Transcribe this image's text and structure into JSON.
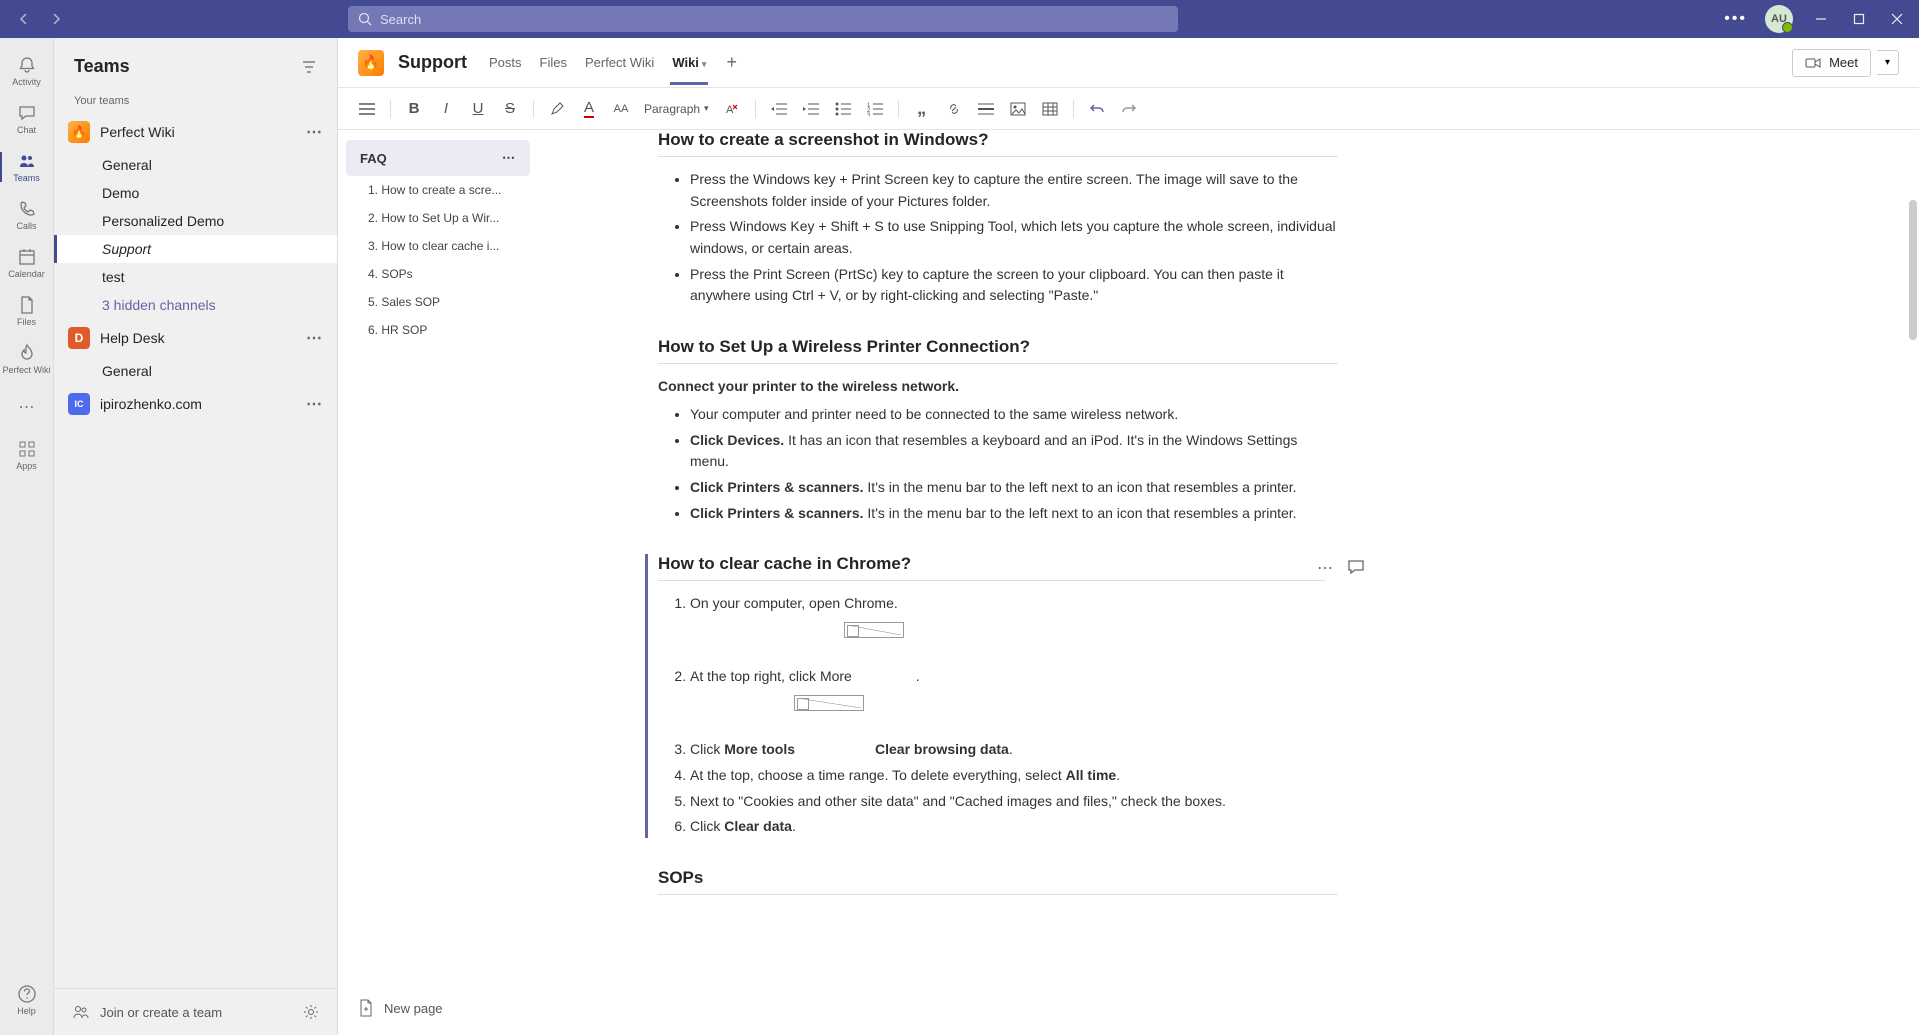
{
  "titlebar": {
    "search_placeholder": "Search",
    "avatar_initials": "AU"
  },
  "rail": {
    "items": [
      {
        "label": "Activity",
        "icon": "🔔"
      },
      {
        "label": "Chat",
        "icon": "💬"
      },
      {
        "label": "Teams",
        "icon": "👥",
        "active": true
      },
      {
        "label": "Calls",
        "icon": "📞"
      },
      {
        "label": "Calendar",
        "icon": "📅"
      },
      {
        "label": "Files",
        "icon": "📄"
      },
      {
        "label": "Perfect Wiki",
        "icon": "🔥"
      },
      {
        "label": "",
        "icon": "⋯"
      },
      {
        "label": "Apps",
        "icon": "⊞"
      }
    ],
    "help_label": "Help"
  },
  "teams_panel": {
    "title": "Teams",
    "your_teams_label": "Your teams",
    "teams": [
      {
        "name": "Perfect Wiki",
        "icon_bg": "linear-gradient(135deg,#ffb347,#ff7b00)",
        "icon_text": "🔥",
        "channels": [
          "General",
          "Demo",
          "Personalized Demo",
          "Support",
          "test"
        ],
        "active_channel": "Support",
        "hidden_link": "3 hidden channels"
      },
      {
        "name": "Help Desk",
        "icon_bg": "#e05b2a",
        "icon_text": "D",
        "channels": [
          "General"
        ]
      },
      {
        "name": "ipirozhenko.com",
        "icon_bg": "#4f6bed",
        "icon_text": "IC",
        "channels": []
      }
    ],
    "join_label": "Join or create a team"
  },
  "header": {
    "channel_title": "Support",
    "tabs": [
      "Posts",
      "Files",
      "Perfect Wiki",
      "Wiki"
    ],
    "active_tab": "Wiki",
    "meet_label": "Meet"
  },
  "toolbar": {
    "paragraph_label": "Paragraph"
  },
  "outline": {
    "title": "FAQ",
    "items": [
      "1. How to create a scre...",
      "2. How to Set Up a Wir...",
      "3. How to clear cache i...",
      "4. SOPs",
      "5. Sales SOP",
      "6. HR SOP"
    ]
  },
  "doc": {
    "sec1": {
      "title": "How to create a screenshot in Windows?",
      "b1": "Press the Windows key + Print Screen key to capture the entire screen. The image will save to the Screenshots folder inside of your Pictures folder.",
      "b2": "Press Windows Key + Shift + S to use Snipping Tool, which lets you capture the whole screen, individual windows, or certain areas.",
      "b3": "Press the Print Screen (PrtSc) key to capture the screen to your clipboard. You can then paste it anywhere using Ctrl + V, or by right-clicking and selecting \"Paste.\""
    },
    "sec2": {
      "title": "How to Set Up a Wireless Printer Connection?",
      "lead_bold": "Connect your printer to the wireless network.",
      "b1": "Your computer and printer need to be connected to the same wireless network.",
      "b2_a": "Click ",
      "b2_b": "Devices.",
      "b2_c": " It has an icon that resembles a keyboard and an iPod. It's in the Windows Settings menu.",
      "b3_a": "Click ",
      "b3_b": "Printers & scanners.",
      "b3_c": " It's in the menu bar to the left next to an icon that resembles a printer.",
      "b4_a": "Click ",
      "b4_b": "Printers & scanners.",
      "b4_c": " It's in the menu bar to the left next to an icon that resembles a printer."
    },
    "sec3": {
      "title": "How to clear cache in Chrome?",
      "o1": "On your computer, open Chrome.",
      "o2": "At the top right, click More ",
      "o3_a": "Click ",
      "o3_b": "More tools",
      "o3_c": "Clear browsing data",
      "o3_d": ".",
      "o4_a": "At the top, choose a time range. To delete everything, select ",
      "o4_b": "All time",
      "o4_c": ".",
      "o5": "Next to \"Cookies and other site data\" and \"Cached images and files,\" check the boxes.",
      "o6_a": "Click ",
      "o6_b": "Clear data",
      "o6_c": "."
    },
    "sec4": {
      "title": "SOPs"
    }
  },
  "newpage_label": "New page"
}
